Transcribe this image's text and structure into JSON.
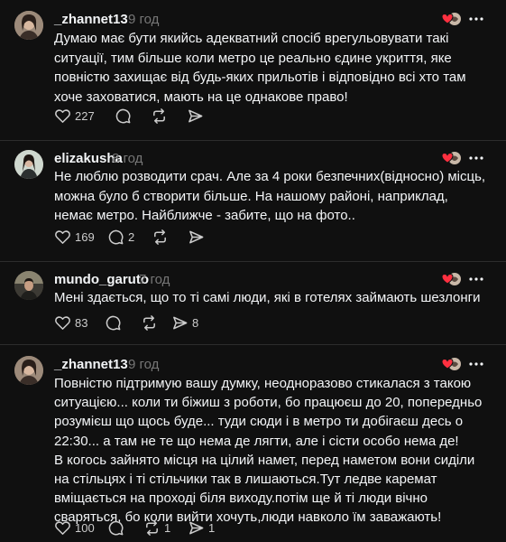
{
  "posts": [
    {
      "username": "_zhannet13",
      "time": "9 год",
      "text": "Думаю має бути якийсь адекватний спосіб врегульовувати такі ситуації, тим більше коли метро це реально єдине укриття, яке повністю захищає від будь-яких прильотів і відповідно всі хто там хоче заховатися, мають на це однакове право!",
      "likes": "227",
      "replies": "",
      "reposts": "",
      "shares": ""
    },
    {
      "username": "elizakusha",
      "time": "8 год",
      "text": "Не люблю розводити срач. Але за 4 роки безпечних(відносно) місць, можна було б створити більше. На нашому районі, наприклад, немає метро. Найближче - забите, що на фото..",
      "likes": "169",
      "replies": "2",
      "reposts": "",
      "shares": ""
    },
    {
      "username": "mundo_garuto",
      "time": "7 год",
      "text": "Мені здається, що то ті самі люди, які в готелях займають шезлонги",
      "likes": "83",
      "replies": "",
      "reposts": "",
      "shares": "8"
    },
    {
      "username": "_zhannet13",
      "time": "9 год",
      "text": "Повністю підтримую вашу думку, неодноразово стикалася з такою ситуацією... коли ти біжиш з роботи, бо працюєш до 20, попередньо розумієш що щось буде... туди сюди і в метро ти добігаєш десь о 22:30... а там не те що нема де лягти, але і сісти особо нема де!\nВ когось зайнято місця на цілий намет, перед наметом вони сиділи на стільцях і ті стільчики так в лишаються.Тут ледве каремат вміщається на проході біля виходу.потім ще й ті люди вічно сваряться, бо коли вийти хочуть,люди навколо їм заважають!",
      "likes": "100",
      "replies": "",
      "reposts": "1",
      "shares": "1"
    }
  ],
  "icons": {
    "like": "heart-icon",
    "reply": "comment-icon",
    "repost": "repost-icon",
    "share": "send-icon",
    "more": "more-icon",
    "reaction": "reacted-avatars-icon"
  },
  "colors": {
    "background": "#101010",
    "text": "#f3f5f7",
    "muted": "#777777",
    "divider": "#2d2d2d",
    "reaction_red": "#ff3040"
  }
}
